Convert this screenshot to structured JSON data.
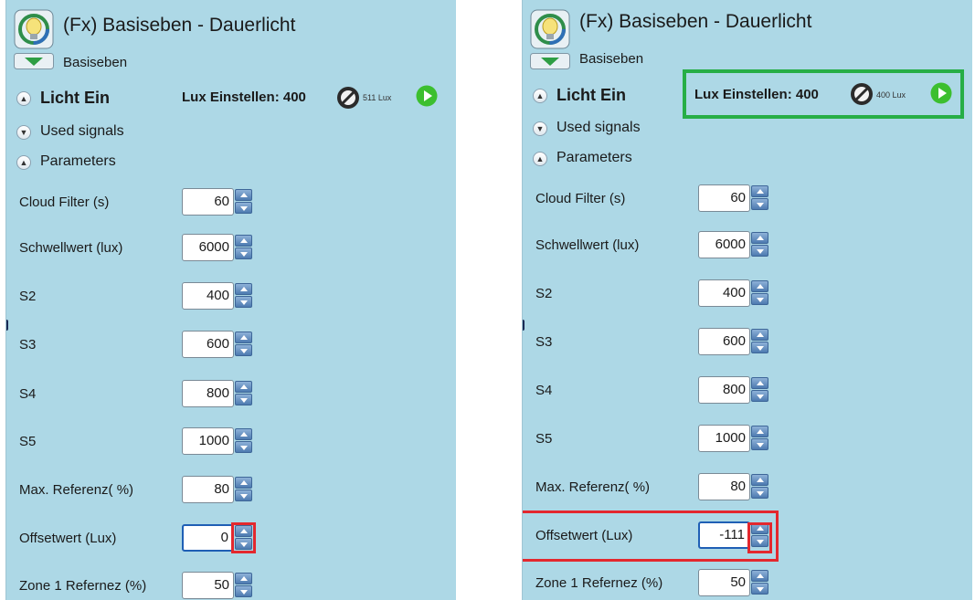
{
  "colors": {
    "panel_bg": "#add8e6",
    "spinner": "#4d7bb0",
    "highlight_red": "#e3282e",
    "highlight_green": "#27ae46",
    "play": "#3cbf2f"
  },
  "icons": {
    "header": "lightbulb-icon",
    "expand": "chevron-down-icon",
    "knob": "dial-icon",
    "play": "play-icon",
    "collapse": "chevron-up-icon"
  },
  "left": {
    "title": "(Fx) Basiseben - Dauerlicht",
    "subtitle": "Basiseben",
    "licht_ein": "Licht Ein",
    "lux_label": "Lux Einstellen: 400",
    "lux_measured": "511 Lux",
    "used_signals": "Used signals",
    "parameters": "Parameters",
    "params": [
      {
        "label": "Cloud Filter (s)",
        "value": "60"
      },
      {
        "label": "Schwellwert (lux)",
        "value": "6000"
      },
      {
        "label": "S2",
        "value": "400"
      },
      {
        "label": "S3",
        "value": "600"
      },
      {
        "label": "S4",
        "value": "800"
      },
      {
        "label": "S5",
        "value": "1000"
      },
      {
        "label": "Max. Referenz( %)",
        "value": "80"
      },
      {
        "label": "Offsetwert (Lux)",
        "value": "0"
      },
      {
        "label": "Zone 1 Refernez (%)",
        "value": "50"
      }
    ]
  },
  "right": {
    "title": "(Fx) Basiseben - Dauerlicht",
    "subtitle": "Basiseben",
    "licht_ein": "Licht Ein",
    "lux_label": "Lux Einstellen: 400",
    "lux_measured": "400 Lux",
    "used_signals": "Used signals",
    "parameters": "Parameters",
    "params": [
      {
        "label": "Cloud Filter (s)",
        "value": "60"
      },
      {
        "label": "Schwellwert (lux)",
        "value": "6000"
      },
      {
        "label": "S2",
        "value": "400"
      },
      {
        "label": "S3",
        "value": "600"
      },
      {
        "label": "S4",
        "value": "800"
      },
      {
        "label": "S5",
        "value": "1000"
      },
      {
        "label": "Max. Referenz( %)",
        "value": "80"
      },
      {
        "label": "Offsetwert (Lux)",
        "value": "-111"
      },
      {
        "label": "Zone 1 Refernez (%)",
        "value": "50"
      }
    ]
  }
}
